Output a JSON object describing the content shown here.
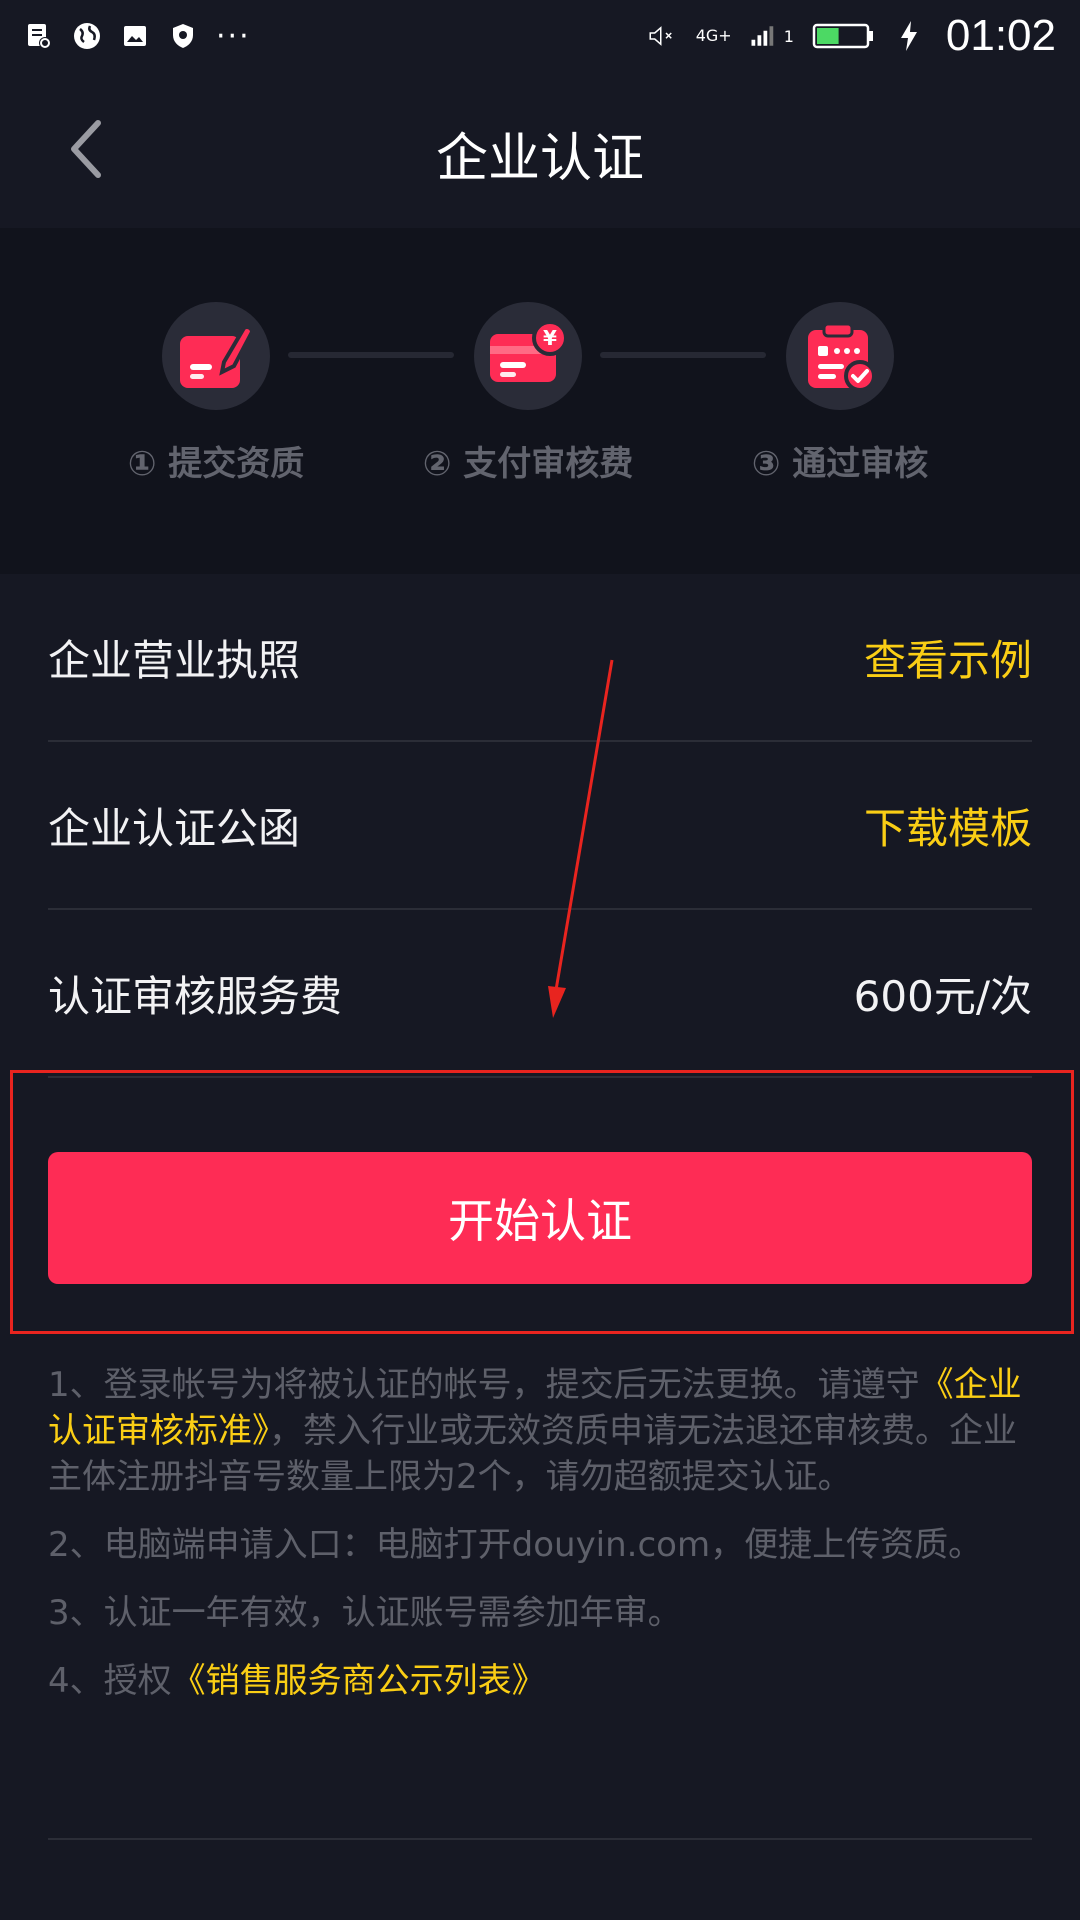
{
  "status_bar": {
    "time": "01:02",
    "network": "4G+",
    "sim_slot": "1",
    "left_icons": [
      "notification-icon",
      "globe-icon",
      "image-icon",
      "shield-icon"
    ],
    "more_indicator": "···",
    "battery_level": 0.45
  },
  "nav": {
    "title": "企业认证"
  },
  "steps": [
    {
      "label": "① 提交资质",
      "icon": "edit-document-icon"
    },
    {
      "label": "② 支付审核费",
      "icon": "card-payment-icon"
    },
    {
      "label": "③ 通过审核",
      "icon": "approved-clipboard-icon"
    }
  ],
  "rows": {
    "license": {
      "label": "企业营业执照",
      "action": "查看示例"
    },
    "letter": {
      "label": "企业认证公函",
      "action": "下载模板"
    },
    "fee": {
      "label": "认证审核服务费",
      "value": "600元/次"
    }
  },
  "start_button": "开始认证",
  "notes": {
    "n1_a": "1、登录帐号为将被认证的帐号，提交后无法更换。请遵守",
    "n1_link": "《企业认证审核标准》",
    "n1_b": "，禁入行业或无效资质申请无法退还审核费。企业主体注册抖音号数量上限为2个，请勿超额提交认证。",
    "n2": "2、电脑端申请入口：电脑打开douyin.com，便捷上传资质。",
    "n3": "3、认证一年有效，认证账号需参加年审。",
    "n4_a": "4、授权",
    "n4_link": "《销售服务商公示列表》"
  },
  "colors": {
    "background": "#161823",
    "accent": "#fe2c55",
    "link": "#face15",
    "annotation": "#e8241f"
  }
}
